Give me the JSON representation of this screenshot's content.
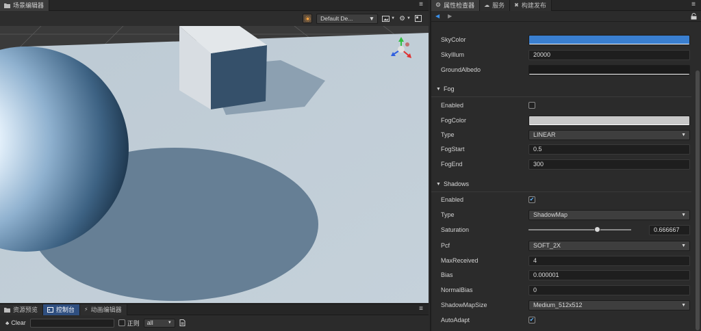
{
  "scene_editor": {
    "tab_label": "场景编辑器",
    "camera_select": "Default De...",
    "menu_icon": "menu-icon"
  },
  "bottom_panel": {
    "tabs": [
      {
        "label": "资源预览"
      },
      {
        "label": "控制台"
      },
      {
        "label": "动画编辑器"
      }
    ],
    "clear_label": "Clear",
    "regex_label": "正则",
    "level_select": "all"
  },
  "inspector": {
    "tabs": [
      {
        "label": "属性检查器"
      },
      {
        "label": "服务"
      },
      {
        "label": "构建发布"
      }
    ],
    "skybox": {
      "sky_color_label": "SkyColor",
      "sky_color": "#3a7fd0",
      "sky_illum_label": "SkyIllum",
      "sky_illum": "20000",
      "ground_albedo_label": "GroundAlbedo",
      "ground_albedo": "#1a1a1a"
    },
    "fog": {
      "title": "Fog",
      "enabled_label": "Enabled",
      "enabled": false,
      "fog_color_label": "FogColor",
      "fog_color": "#c8c8c8",
      "type_label": "Type",
      "type": "LINEAR",
      "fog_start_label": "FogStart",
      "fog_start": "0.5",
      "fog_end_label": "FogEnd",
      "fog_end": "300"
    },
    "shadows": {
      "title": "Shadows",
      "enabled_label": "Enabled",
      "enabled": true,
      "type_label": "Type",
      "type": "ShadowMap",
      "saturation_label": "Saturation",
      "saturation": "0.666667",
      "saturation_fraction": 0.666667,
      "pcf_label": "Pcf",
      "pcf": "SOFT_2X",
      "max_received_label": "MaxReceived",
      "max_received": "4",
      "bias_label": "Bias",
      "bias": "0.000001",
      "normal_bias_label": "NormalBias",
      "normal_bias": "0",
      "shadow_map_size_label": "ShadowMapSize",
      "shadow_map_size": "Medium_512x512",
      "auto_adapt_label": "AutoAdapt",
      "auto_adapt": true
    }
  },
  "colors": {
    "accent": "#3a7fd0",
    "checkbox_check": "#5fb4ff"
  }
}
